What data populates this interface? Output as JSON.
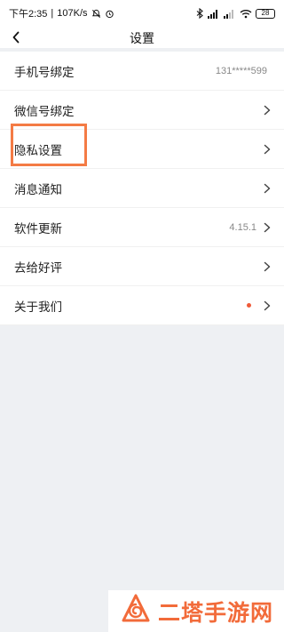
{
  "status_bar": {
    "time": "下午2:35",
    "net_speed": "107K/s",
    "battery": "28"
  },
  "header": {
    "title": "设置"
  },
  "items": [
    {
      "label": "手机号绑定",
      "value": "131*****599",
      "has_chevron": false
    },
    {
      "label": "微信号绑定",
      "value": "",
      "has_chevron": true
    },
    {
      "label": "隐私设置",
      "value": "",
      "has_chevron": true
    },
    {
      "label": "消息通知",
      "value": "",
      "has_chevron": true
    },
    {
      "label": "软件更新",
      "value": "4.15.1",
      "has_chevron": true
    },
    {
      "label": "去给好评",
      "value": "",
      "has_chevron": true
    },
    {
      "label": "关于我们",
      "value": "",
      "has_chevron": true,
      "red_dot": true
    }
  ],
  "watermark": {
    "text": "二塔手游网",
    "color": "#f26b3a"
  },
  "colors": {
    "accent_highlight": "#f47b45",
    "red_dot": "#ef5a39",
    "background": "#eef0f3"
  }
}
